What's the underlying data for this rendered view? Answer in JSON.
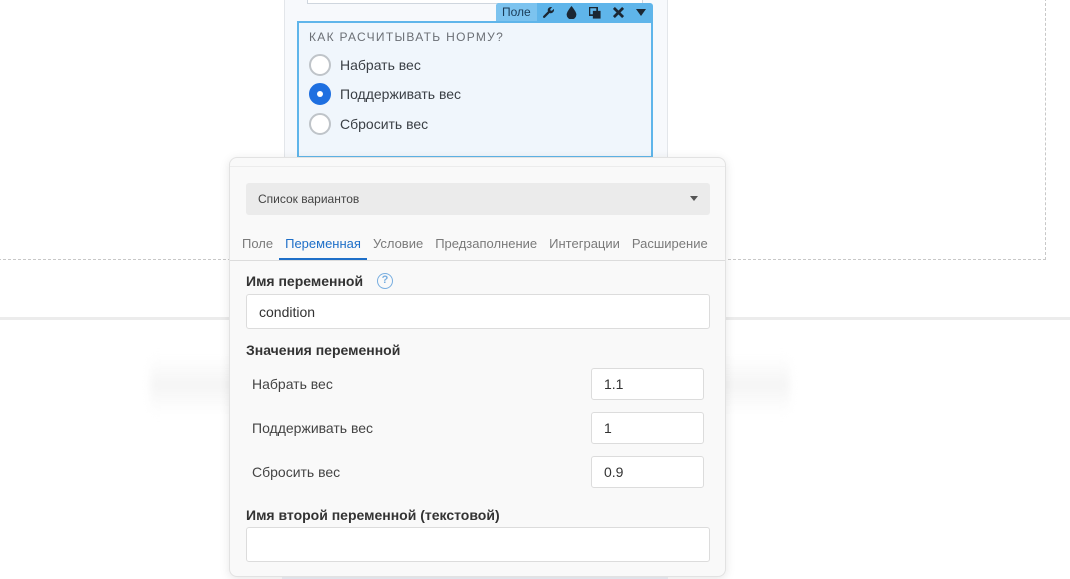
{
  "field_toolbar": {
    "label": "Поле",
    "icons": [
      "wrench-icon",
      "drop-icon",
      "copy-icon",
      "close-icon",
      "chevron-down-icon"
    ]
  },
  "question": {
    "title": "КАК РАСЧИТЫВАТЬ НОРМУ?",
    "options": [
      {
        "label": "Набрать вес",
        "checked": false
      },
      {
        "label": "Поддерживать вес",
        "checked": true
      },
      {
        "label": "Сбросить вес",
        "checked": false
      }
    ]
  },
  "panel": {
    "type_select": "Список вариантов",
    "tabs": [
      "Поле",
      "Переменная",
      "Условие",
      "Предзаполнение",
      "Интеграции",
      "Расширение"
    ],
    "active_tab": "Переменная",
    "var_name_label": "Имя переменной",
    "var_name_value": "condition",
    "var_values_label": "Значения переменной",
    "var_values": [
      {
        "label": "Набрать вес",
        "value": "1.1"
      },
      {
        "label": "Поддерживать вес",
        "value": "1"
      },
      {
        "label": "Сбросить вес",
        "value": "0.9"
      }
    ],
    "second_var_label": "Имя второй переменной (текстовой)",
    "second_var_value": ""
  },
  "colors": {
    "accent": "#1e6fc8",
    "toolbar": "#5fb5ea",
    "radio_checked": "#1e6fe0"
  }
}
